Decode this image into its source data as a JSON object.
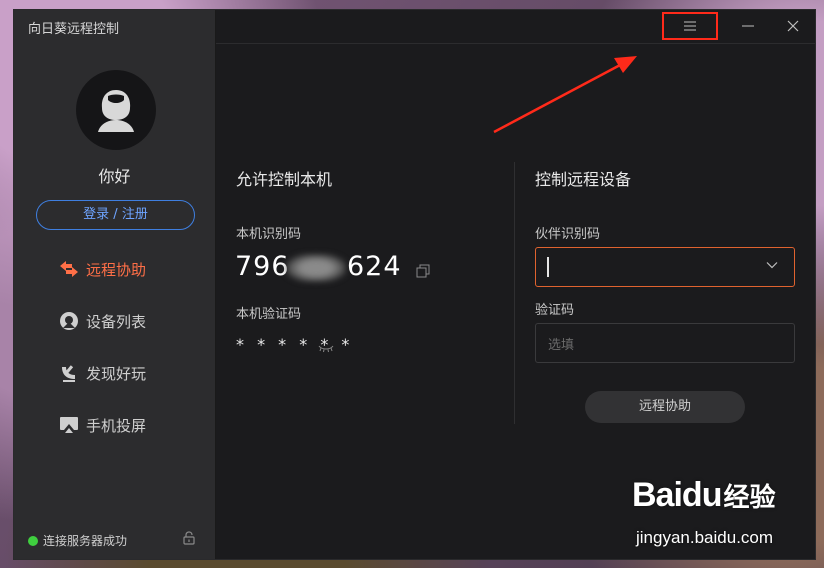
{
  "window": {
    "title": "向日葵远程控制",
    "menu_icon": "hamburger-menu-icon",
    "minimize_icon": "minimize-icon",
    "close_icon": "close-icon"
  },
  "sidebar": {
    "avatar_icon": "user-avatar-icon",
    "greeting": "你好",
    "login_label": "登录 / 注册",
    "items": [
      {
        "label": "远程协助",
        "icon": "remote-assist-icon",
        "active": true
      },
      {
        "label": "设备列表",
        "icon": "device-list-icon",
        "active": false
      },
      {
        "label": "发现好玩",
        "icon": "discover-icon",
        "active": false
      },
      {
        "label": "手机投屏",
        "icon": "screen-cast-icon",
        "active": false
      }
    ],
    "status_text": "连接服务器成功",
    "status_color": "#3fcf3f",
    "lock_icon": "lock-icon"
  },
  "allow_control": {
    "title": "允许控制本机",
    "id_label": "本机识别码",
    "id_prefix": "796",
    "id_suffix": "624",
    "copy_icon": "copy-icon",
    "code_label": "本机验证码",
    "code_value": "* * * * * *",
    "eye_icon": "eye-closed-icon"
  },
  "remote_control": {
    "title": "控制远程设备",
    "partner_label": "伙伴识别码",
    "partner_value": "",
    "dropdown_icon": "chevron-down-icon",
    "code_label": "验证码",
    "code_placeholder": "选填",
    "assist_button": "远程协助"
  },
  "colors": {
    "accent": "#ff6f47",
    "link_blue": "#3f7fe0",
    "annotation_red": "#ff2a1a"
  },
  "watermark": {
    "brand_bai": "Bai",
    "brand_du": "du",
    "brand_cn": "经验",
    "url": "jingyan.baidu.com"
  }
}
